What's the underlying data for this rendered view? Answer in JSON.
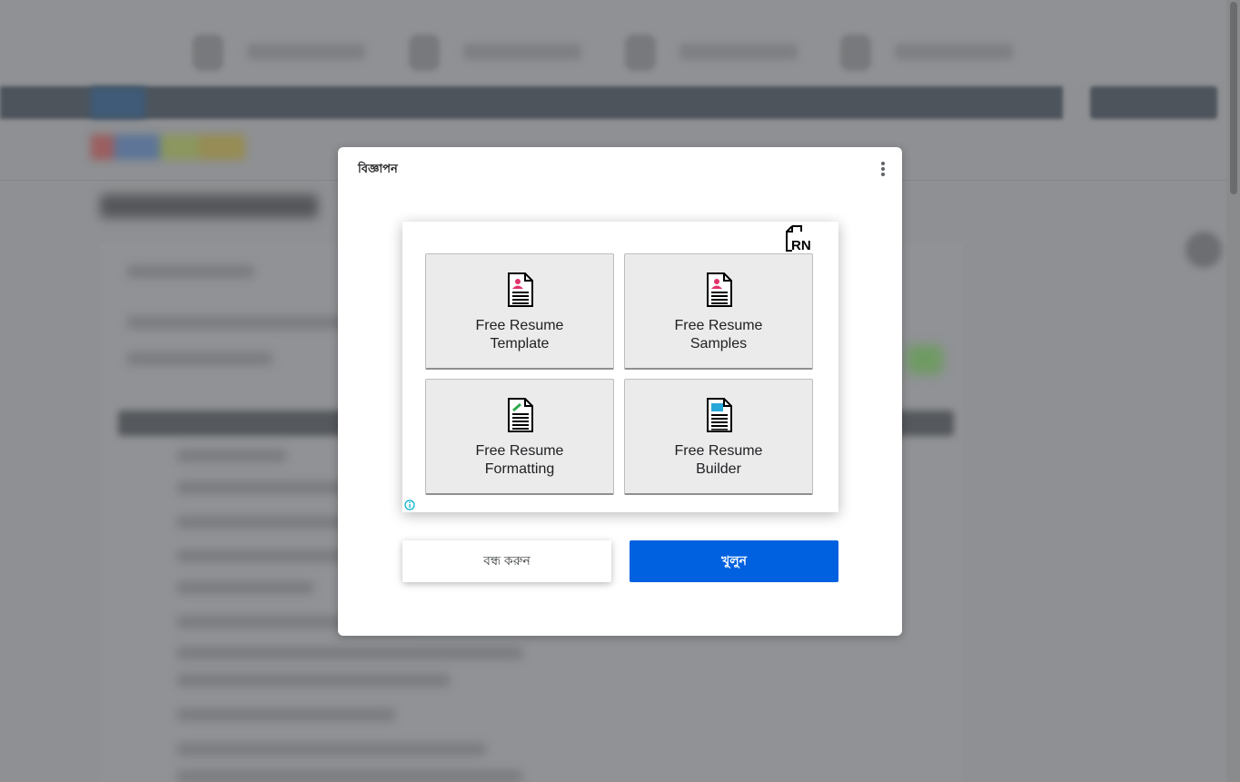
{
  "dialog": {
    "title": "বিজ্ঞাপন",
    "menu_icon": "more-vert-icon"
  },
  "ad": {
    "logo_text": "RN",
    "tiles": [
      {
        "line1": "Free Resume",
        "line2": "Template",
        "icon": "resume-doc-pink-icon"
      },
      {
        "line1": "Free Resume",
        "line2": "Samples",
        "icon": "resume-doc-pink-icon"
      },
      {
        "line1": "Free Resume",
        "line2": "Formatting",
        "icon": "resume-doc-green-icon"
      },
      {
        "line1": "Free Resume",
        "line2": "Builder",
        "icon": "resume-doc-blue-icon"
      }
    ],
    "info_icon": "info-icon"
  },
  "buttons": {
    "close_label": "বন্ধ করুন",
    "open_label": "খুলুন"
  },
  "colors": {
    "primary": "#0061e0",
    "overlay": "#8e9093",
    "tile_bg": "#ebebeb",
    "info": "#00aecd"
  }
}
